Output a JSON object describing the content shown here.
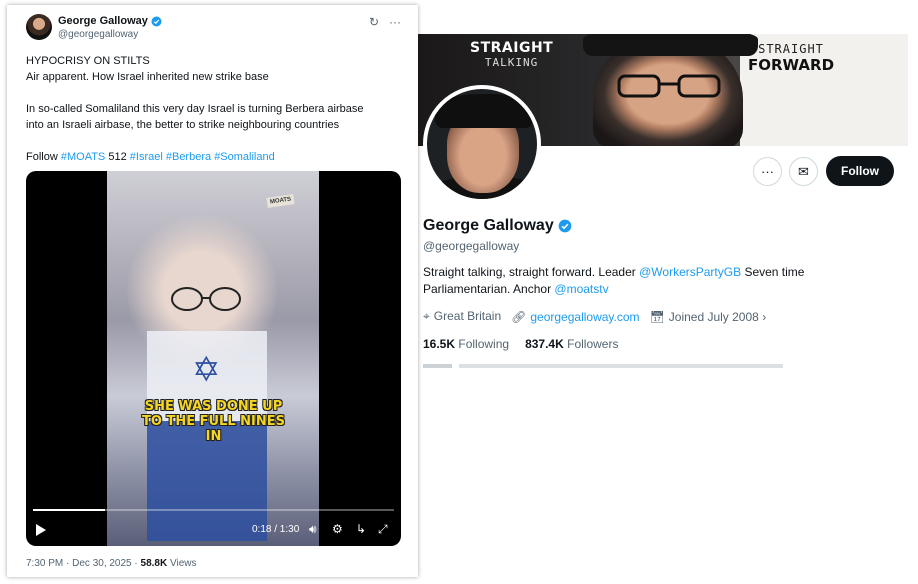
{
  "tweet": {
    "author_name": "George Galloway",
    "author_handle": "@georgegalloway",
    "lines": [
      "HYPOCRISY ON STILTS",
      "Air apparent. How Israel inherited new strike base",
      "In so-called Somaliland this very day Israel is turning Berbera airbase",
      "into an Israeli airbase, the better to strike neighbouring countries"
    ],
    "follow_prefix": "Follow",
    "hashtag_moats": "#MOATS",
    "moats_number": "512",
    "hashtags": [
      "#Israel",
      "#Berbera",
      "#Somaliland"
    ],
    "video": {
      "sign_text": "MOATS",
      "caption": [
        "SHE WAS DONE UP",
        "TO THE FULL NINES",
        "IN"
      ],
      "time": "0:18 / 1:30",
      "progress": 0.2
    },
    "timestamp": "7:30 PM · Dec 30, 2025 · ",
    "views_count": "58.8K",
    "views_label": " Views",
    "icons": {
      "grok": "grok-icon",
      "more": "more-icon"
    }
  },
  "profile": {
    "banner_left_1": "STRAIGHT",
    "banner_left_2": "TALKING",
    "banner_right_1": "STRAIGHT",
    "banner_right_2": "FORWARD",
    "follow_label": "Follow",
    "name": "George Galloway",
    "handle": "@georgegalloway",
    "bio_part1": "Straight talking, straight forward.  Leader ",
    "bio_link1": "@WorkersPartyGB",
    "bio_part2": " Seven time",
    "bio_part3": "Parliamentarian. Anchor ",
    "bio_link2": "@moatstv",
    "location": "Great Britain",
    "website": "georgegalloway.com",
    "joined": "Joined July 2008",
    "following_count": "16.5K",
    "following_label": "Following",
    "followers_count": "837.4K",
    "followers_label": "Followers"
  },
  "colors": {
    "accent": "#1d9bf0",
    "dark": "#0f1419",
    "muted": "#536471"
  }
}
